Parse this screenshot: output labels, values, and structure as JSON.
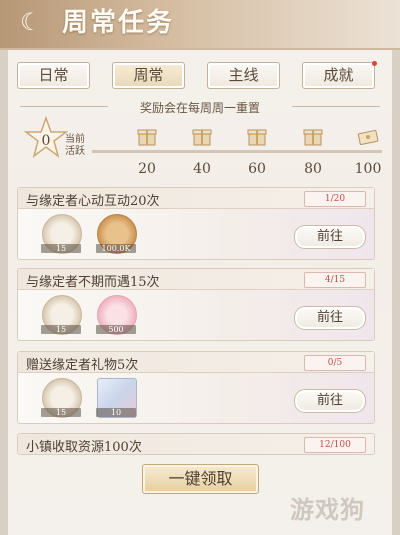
{
  "header": {
    "title": "周常任务"
  },
  "tabs": [
    {
      "label": "日常",
      "active": false
    },
    {
      "label": "周常",
      "active": true
    },
    {
      "label": "主线",
      "active": false
    },
    {
      "label": "成就",
      "active": false,
      "notification": true
    }
  ],
  "reset_note": "奖励会在每周周一重置",
  "activity": {
    "current_value": "0",
    "current_label": "当前活跃",
    "milestones": [
      "20",
      "40",
      "60",
      "80",
      "100"
    ]
  },
  "tasks": [
    {
      "name": "与缘定者心动互动20次",
      "progress": "1/20",
      "rewards": [
        {
          "icon": "paw-coin-icon",
          "count": "15"
        },
        {
          "icon": "gold-coin-icon",
          "count": "100.0K"
        }
      ],
      "button": "前往"
    },
    {
      "name": "与缘定者不期而遇15次",
      "progress": "4/15",
      "rewards": [
        {
          "icon": "paw-coin-icon",
          "count": "15"
        },
        {
          "icon": "pink-paw-icon",
          "count": "500"
        }
      ],
      "button": "前往"
    },
    {
      "name": "赠送缘定者礼物5次",
      "progress": "0/5",
      "rewards": [
        {
          "icon": "paw-coin-icon",
          "count": "15"
        },
        {
          "icon": "ticket-icon",
          "count": "10"
        }
      ],
      "button": "前往"
    },
    {
      "name": "小镇收取资源100次",
      "progress": "12/100"
    }
  ],
  "claim_all": "一键领取",
  "watermark": "游戏狗"
}
